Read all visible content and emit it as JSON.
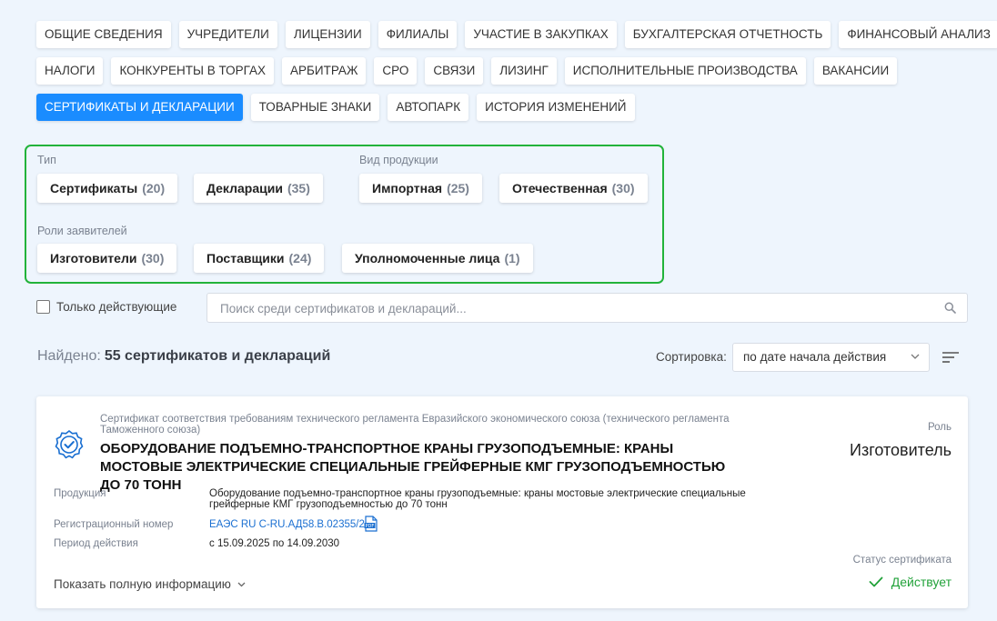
{
  "tabs": {
    "row1": [
      "ОБЩИЕ СВЕДЕНИЯ",
      "УЧРЕДИТЕЛИ",
      "ЛИЦЕНЗИИ",
      "ФИЛИАЛЫ",
      "УЧАСТИЕ В ЗАКУПКАХ",
      "БУХГАЛТЕРСКАЯ ОТЧЕТНОСТЬ",
      "ФИНАНСОВЫЙ АНАЛИЗ"
    ],
    "row2": [
      "НАЛОГИ",
      "КОНКУРЕНТЫ В ТОРГАХ",
      "АРБИТРАЖ",
      "СРО",
      "СВЯЗИ",
      "ЛИЗИНГ",
      "ИСПОЛНИТЕЛЬНЫЕ ПРОИЗВОДСТВА",
      "ВАКАНСИИ"
    ],
    "row3": [
      "СЕРТИФИКАТЫ И ДЕКЛАРАЦИИ",
      "ТОВАРНЫЕ ЗНАКИ",
      "АВТОПАРК",
      "ИСТОРИЯ ИЗМЕНЕНИЙ"
    ],
    "active": "СЕРТИФИКАТЫ И ДЕКЛАРАЦИИ"
  },
  "filters": {
    "type_label": "Тип",
    "type": [
      {
        "label": "Сертификаты",
        "count": "(20)"
      },
      {
        "label": "Декларации",
        "count": "(35)"
      }
    ],
    "product_label": "Вид продукции",
    "product": [
      {
        "label": "Импортная",
        "count": "(25)"
      },
      {
        "label": "Отечественная",
        "count": "(30)"
      }
    ],
    "roles_label": "Роли заявителей",
    "roles": [
      {
        "label": "Изготовители",
        "count": "(30)"
      },
      {
        "label": "Поставщики",
        "count": "(24)"
      },
      {
        "label": "Уполномоченные лица",
        "count": "(1)"
      }
    ]
  },
  "only_active_label": "Только действующие",
  "search": {
    "placeholder": "Поиск среди сертификатов и деклараций..."
  },
  "results": {
    "found_label": "Найдено:",
    "found_value": "55 сертификатов и деклараций"
  },
  "sort": {
    "label": "Сортировка:",
    "value": "по дате начала действия"
  },
  "card": {
    "subtitle": "Сертификат соответствия требованиям технического регламента Евразийского экономического союза (технического регламента Таможенного союза)",
    "title": "ОБОРУДОВАНИЕ ПОДЪЕМНО-ТРАНСПОРТНОЕ КРАНЫ ГРУЗОПОДЪЕМНЫЕ: КРАНЫ МОСТОВЫЕ ЭЛЕКТРИЧЕСКИЕ СПЕЦИАЛЬНЫЕ ГРЕЙФЕРНЫЕ КМГ ГРУЗОПОДЪЕМНОСТЬЮ ДО 70 ТОНН",
    "role_label": "Роль",
    "role_value": "Изготовитель",
    "product_label": "Продукция",
    "product_value": "Оборудование подъемно-транспортное краны грузоподъемные: краны мостовые электрические специальные грейферные КМГ грузоподъемностью до 70 тонн",
    "reg_label": "Регистрационный номер",
    "reg_value": "ЕАЭС RU C-RU.АД58.В.02355/25",
    "period_label": "Период действия",
    "period_value": "с 15.09.2025 по 14.09.2030",
    "status_label": "Статус сертификата",
    "status_value": "Действует",
    "show_more": "Показать полную информацию",
    "status_color": "#22a23a"
  },
  "colors": {
    "accent": "#1a8cff",
    "filter_border": "#22b33a",
    "background": "#eef5fd"
  }
}
